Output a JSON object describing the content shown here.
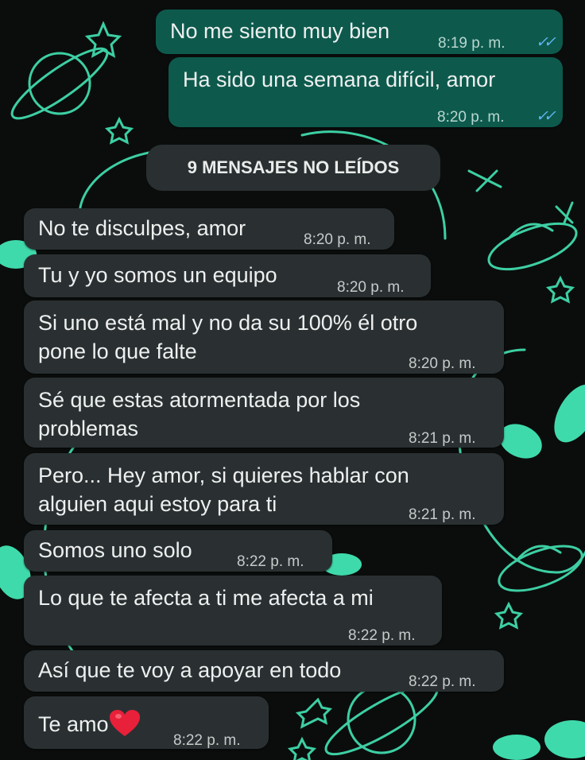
{
  "theme": {
    "wallpaper_bg": "#0b0d0c",
    "wallpaper_accent": "#43e6b5",
    "incoming_bubble": "#2a3032",
    "outgoing_bubble": "#0d5a4d",
    "read_ticks": "#5fb4f0"
  },
  "outgoing": [
    {
      "text": "No me siento muy bien",
      "time": "8:19 p. m.",
      "status": "read-double-check-icon"
    },
    {
      "text": "Ha sido una semana difícil, amor",
      "time": "8:20 p. m.",
      "status": "read-double-check-icon"
    }
  ],
  "unread_divider": "9 MENSAJES NO LEÍDOS",
  "incoming": [
    {
      "lines": [
        "No te disculpes, amor"
      ],
      "time": "8:20 p. m."
    },
    {
      "lines": [
        "Tu y yo somos un equipo"
      ],
      "time": "8:20 p. m."
    },
    {
      "lines": [
        "Si uno está mal y no da su 100% él otro",
        "pone lo que falte"
      ],
      "time": "8:20 p. m."
    },
    {
      "lines": [
        "Sé que estas atormentada por los",
        "problemas"
      ],
      "time": "8:21 p. m."
    },
    {
      "lines": [
        "Pero... Hey amor, si quieres hablar con",
        "alguien aqui estoy para ti"
      ],
      "time": "8:21 p. m."
    },
    {
      "lines": [
        "Somos uno solo"
      ],
      "time": "8:22 p. m."
    },
    {
      "lines": [
        "Lo que te afecta a ti me afecta a mi"
      ],
      "time": "8:22 p. m."
    },
    {
      "lines": [
        "Así que te voy a apoyar en todo"
      ],
      "time": "8:22 p. m."
    },
    {
      "lines": [
        "Te amo"
      ],
      "emoji": "red-heart-icon",
      "time": "8:22 p. m."
    }
  ]
}
